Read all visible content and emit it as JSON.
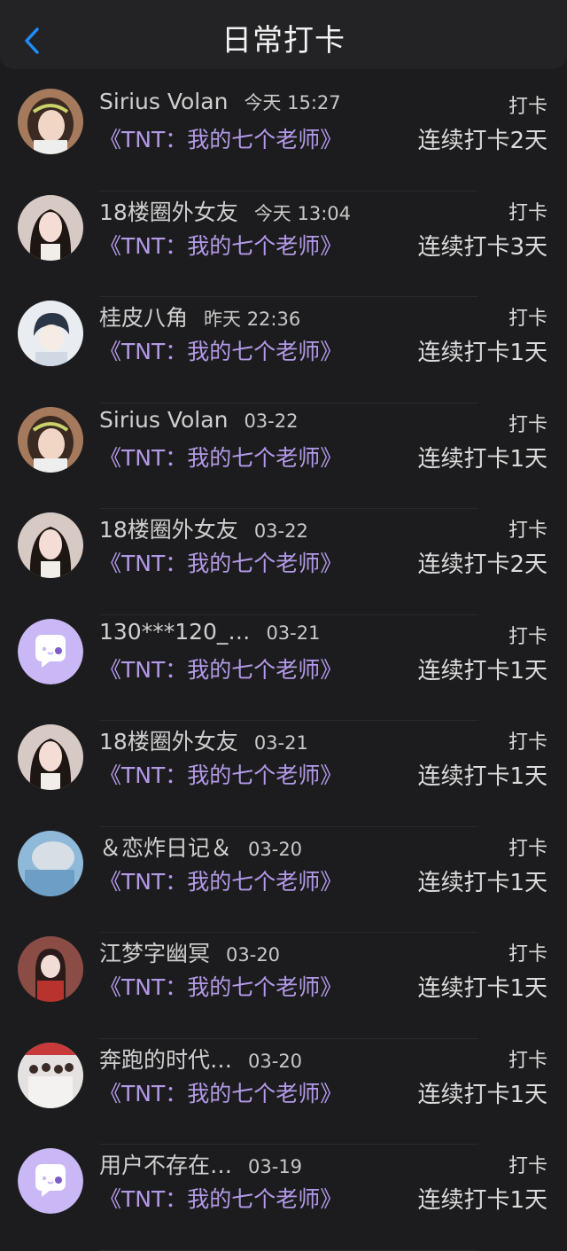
{
  "header": {
    "title": "日常打卡"
  },
  "rows": [
    {
      "avatar": "girl-headband",
      "name": "Sirius Volan",
      "time": "今天 15:27",
      "book": "《TNT：我的七个老师》",
      "action": "打卡",
      "streak": "连续打卡2天"
    },
    {
      "avatar": "girl-longhair",
      "name": "18楼圈外女友",
      "time": "今天 13:04",
      "book": "《TNT：我的七个老师》",
      "action": "打卡",
      "streak": "连续打卡3天"
    },
    {
      "avatar": "anime-boy",
      "name": "桂皮八角",
      "time": "昨天 22:36",
      "book": "《TNT：我的七个老师》",
      "action": "打卡",
      "streak": "连续打卡1天"
    },
    {
      "avatar": "girl-headband",
      "name": "Sirius Volan",
      "time": "03-22",
      "book": "《TNT：我的七个老师》",
      "action": "打卡",
      "streak": "连续打卡1天"
    },
    {
      "avatar": "girl-longhair",
      "name": "18楼圈外女友",
      "time": "03-22",
      "book": "《TNT：我的七个老师》",
      "action": "打卡",
      "streak": "连续打卡2天"
    },
    {
      "avatar": "default-chat",
      "name": "130***120_…",
      "time": "03-21",
      "book": "《TNT：我的七个老师》",
      "action": "打卡",
      "streak": "连续打卡1天"
    },
    {
      "avatar": "girl-longhair",
      "name": "18楼圈外女友",
      "time": "03-21",
      "book": "《TNT：我的七个老师》",
      "action": "打卡",
      "streak": "连续打卡1天"
    },
    {
      "avatar": "blue-hat",
      "name": "＆恋炸日记＆",
      "time": "03-20",
      "book": "《TNT：我的七个老师》",
      "action": "打卡",
      "streak": "连续打卡1天"
    },
    {
      "avatar": "red-costume",
      "name": "江梦字幽冥",
      "time": "03-20",
      "book": "《TNT：我的七个老师》",
      "action": "打卡",
      "streak": "连续打卡1天"
    },
    {
      "avatar": "group-photo",
      "name": "奔跑的时代…",
      "time": "03-20",
      "book": "《TNT：我的七个老师》",
      "action": "打卡",
      "streak": "连续打卡1天"
    },
    {
      "avatar": "default-chat",
      "name": "用户不存在…",
      "time": "03-19",
      "book": "《TNT：我的七个老师》",
      "action": "打卡",
      "streak": "连续打卡1天"
    }
  ],
  "colors": {
    "accent_blue": "#1e8cff",
    "book_purple": "#b39ae8",
    "default_avatar": "#c9b8f5"
  }
}
